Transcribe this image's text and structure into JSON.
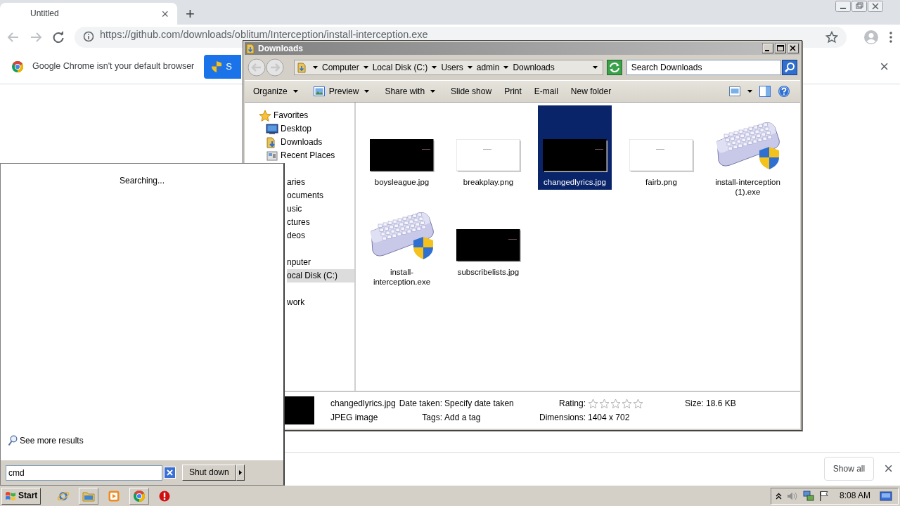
{
  "browser": {
    "tab": {
      "title": "Untitled",
      "close": "×"
    },
    "new_tab": "+",
    "address": "https://github.com/downloads/oblitum/Interception/install-interception.exe",
    "infobar": {
      "message": "Google Chrome isn't your default browser",
      "button": "S",
      "close": "×"
    },
    "downloads_shelf": {
      "show_all": "Show all",
      "close": "×"
    }
  },
  "explorer": {
    "title": "Downloads",
    "breadcrumb": [
      "Computer",
      "Local Disk (C:)",
      "Users",
      "admin",
      "Downloads"
    ],
    "search": {
      "placeholder": "Search Downloads"
    },
    "toolbar": [
      {
        "label": "Organize",
        "kind": "text",
        "dropdown": true
      },
      {
        "label": "Preview",
        "kind": "image",
        "dropdown": true
      },
      {
        "label": "Share with",
        "kind": "text",
        "dropdown": true
      },
      {
        "label": "Slide show",
        "kind": "text",
        "dropdown": false
      },
      {
        "label": "Print",
        "kind": "text",
        "dropdown": false
      },
      {
        "label": "E-mail",
        "kind": "text",
        "dropdown": false
      },
      {
        "label": "New folder",
        "kind": "text",
        "dropdown": false
      }
    ],
    "nav": [
      {
        "label": "Favorites",
        "kind": "star",
        "selected": false,
        "children": [
          {
            "label": "Desktop",
            "kind": "desktop",
            "selected": false
          },
          {
            "label": "Downloads",
            "kind": "downloads",
            "selected": false
          },
          {
            "label": "Recent Places",
            "kind": "recent",
            "selected": false
          }
        ]
      },
      {
        "label": "aries",
        "kind": "covered",
        "selected": false,
        "children": [
          {
            "label": "ocuments",
            "kind": "covered",
            "selected": false
          },
          {
            "label": "usic",
            "kind": "covered",
            "selected": false
          },
          {
            "label": "ctures",
            "kind": "covered",
            "selected": false
          },
          {
            "label": "deos",
            "kind": "covered",
            "selected": false
          }
        ]
      },
      {
        "label": "nputer",
        "kind": "covered",
        "selected": false,
        "children": [
          {
            "label": "ocal Disk (C:)",
            "kind": "covered",
            "selected": true
          }
        ]
      },
      {
        "label": "work",
        "kind": "covered",
        "selected": false
      }
    ],
    "files": [
      {
        "name": "boysleague.jpg",
        "kind": "dark-image",
        "selected": false
      },
      {
        "name": "breakplay.png",
        "kind": "light-image",
        "selected": false
      },
      {
        "name": "changedlyrics.jpg",
        "kind": "dark-image",
        "selected": true
      },
      {
        "name": "fairb.png",
        "kind": "light-image",
        "selected": false
      },
      {
        "name": "install-interception (1).exe",
        "kind": "installer",
        "selected": false
      },
      {
        "name": "install-interception.exe",
        "kind": "installer",
        "selected": false
      },
      {
        "name": "subscribelists.jpg",
        "kind": "dark-image",
        "selected": false
      }
    ],
    "details": {
      "name": "changedlyrics.jpg",
      "type": "JPEG image",
      "date_taken": {
        "label": "Date taken:",
        "value": "Specify date taken"
      },
      "tags": {
        "label": "Tags:",
        "value": "Add a tag"
      },
      "rating": {
        "label": "Rating:",
        "stars": 0
      },
      "dimensions": {
        "label": "Dimensions:",
        "value": "1404 x 702"
      },
      "size": {
        "label": "Size:",
        "value": "18.6 KB"
      }
    }
  },
  "start_menu": {
    "status": "Searching...",
    "see_more": "See more results",
    "search": {
      "value": "cmd"
    },
    "shutdown": "Shut down"
  },
  "taskbar": {
    "start": "Start",
    "clock": "8:08 AM"
  }
}
